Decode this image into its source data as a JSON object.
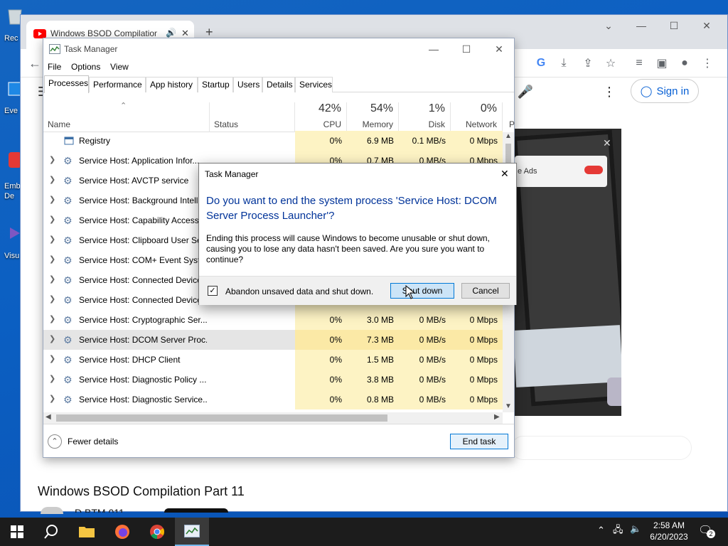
{
  "desktop": {
    "icons": [
      {
        "label": "Rec"
      },
      {
        "label": "Eve"
      },
      {
        "label": "Emb"
      },
      {
        "label": "De"
      },
      {
        "label": "Visu"
      }
    ]
  },
  "browser": {
    "tab_title": "Windows BSOD Compilation",
    "sign_in_label": "Sign in",
    "video_title": "Windows BSOD Compilation Part 11",
    "channel_partial": "D   BTM 011",
    "overlay_text": "e Ads"
  },
  "task_manager": {
    "title": "Task Manager",
    "menu": [
      "File",
      "Options",
      "View"
    ],
    "tabs": [
      "Processes",
      "Performance",
      "App history",
      "Startup",
      "Users",
      "Details",
      "Services"
    ],
    "columns": {
      "name": "Name",
      "status": "Status",
      "cpu": {
        "pct": "42%",
        "label": "CPU"
      },
      "memory": {
        "pct": "54%",
        "label": "Memory"
      },
      "disk": {
        "pct": "1%",
        "label": "Disk"
      },
      "network": {
        "pct": "0%",
        "label": "Network"
      },
      "power_partial": "P"
    },
    "rows": [
      {
        "name": "Registry",
        "cpu": "0%",
        "mem": "6.9 MB",
        "disk": "0.1 MB/s",
        "net": "0 Mbps"
      },
      {
        "name": "Service Host: Application Infor...",
        "cpu": "0%",
        "mem": "0.7 MB",
        "disk": "0 MB/s",
        "net": "0 Mbps"
      },
      {
        "name": "Service Host: AVCTP service"
      },
      {
        "name": "Service Host: Background Intelli"
      },
      {
        "name": "Service Host: Capability Access"
      },
      {
        "name": "Service Host: Clipboard User Ser"
      },
      {
        "name": "Service Host: COM+ Event Syste"
      },
      {
        "name": "Service Host: Connected Device"
      },
      {
        "name": "Service Host: Connected Device"
      },
      {
        "name": "Service Host: Cryptographic Ser...",
        "cpu": "0%",
        "mem": "3.0 MB",
        "disk": "0 MB/s",
        "net": "0 Mbps"
      },
      {
        "name": "Service Host: DCOM Server Proc...",
        "cpu": "0%",
        "mem": "7.3 MB",
        "disk": "0 MB/s",
        "net": "0 Mbps"
      },
      {
        "name": "Service Host: DHCP Client",
        "cpu": "0%",
        "mem": "1.5 MB",
        "disk": "0 MB/s",
        "net": "0 Mbps"
      },
      {
        "name": "Service Host: Diagnostic Policy ...",
        "cpu": "0%",
        "mem": "3.8 MB",
        "disk": "0 MB/s",
        "net": "0 Mbps"
      },
      {
        "name": "Service Host: Diagnostic Service...",
        "cpu": "0%",
        "mem": "0.8 MB",
        "disk": "0 MB/s",
        "net": "0 Mbps"
      }
    ],
    "fewer_details": "Fewer details",
    "end_task": "End task"
  },
  "dialog": {
    "title": "Task Manager",
    "heading": "Do you want to end the system process 'Service Host: DCOM Server Process Launcher'?",
    "body": "Ending this process will cause Windows to become unusable or shut down, causing you to lose any data hasn't been saved. Are you sure you want to continue?",
    "checkbox_label": "Abandon unsaved data and shut down.",
    "checkbox_checked": true,
    "shutdown_label": "Shut down",
    "cancel_label": "Cancel"
  },
  "taskbar": {
    "time": "2:58 AM",
    "date": "6/20/2023",
    "notification_count": "2"
  }
}
